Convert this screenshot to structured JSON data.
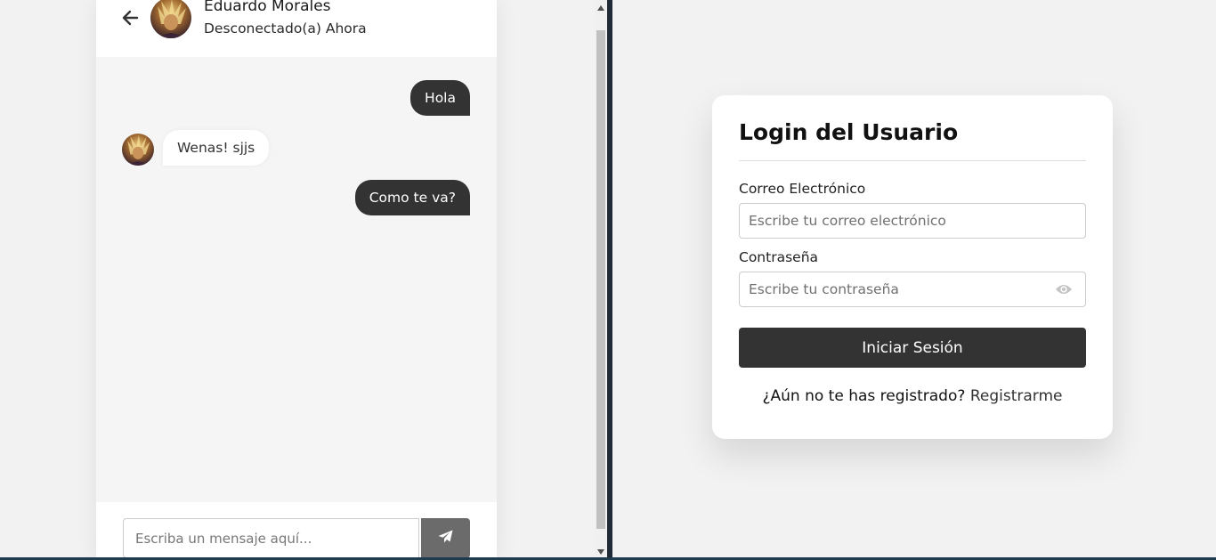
{
  "chat": {
    "contact": {
      "name": "Eduardo Morales",
      "status": "Desconectado(a) Ahora"
    },
    "messages": [
      {
        "direction": "outgoing",
        "text": "Hola"
      },
      {
        "direction": "incoming",
        "text": "Wenas! sjjs"
      },
      {
        "direction": "outgoing",
        "text": "Como te va?"
      }
    ],
    "composer": {
      "placeholder": "Escriba un mensaje aquí...",
      "send_icon": "paper-plane-icon"
    },
    "icons": {
      "back": "arrow-left-icon"
    }
  },
  "login": {
    "title": "Login del Usuario",
    "email": {
      "label": "Correo Electrónico",
      "placeholder": "Escribe tu correo electrónico"
    },
    "password": {
      "label": "Contraseña",
      "placeholder": "Escribe tu contraseña",
      "toggle_icon": "eye-icon"
    },
    "submit_label": "Iniciar Sesión",
    "signup": {
      "prompt": "¿Aún no te has registrado?",
      "link": "Registrarme"
    }
  },
  "colors": {
    "primary_dark": "#333333",
    "send_button": "#6b6b6b",
    "page_background": "#f2f2f2",
    "chat_background": "#f5f5f5"
  }
}
